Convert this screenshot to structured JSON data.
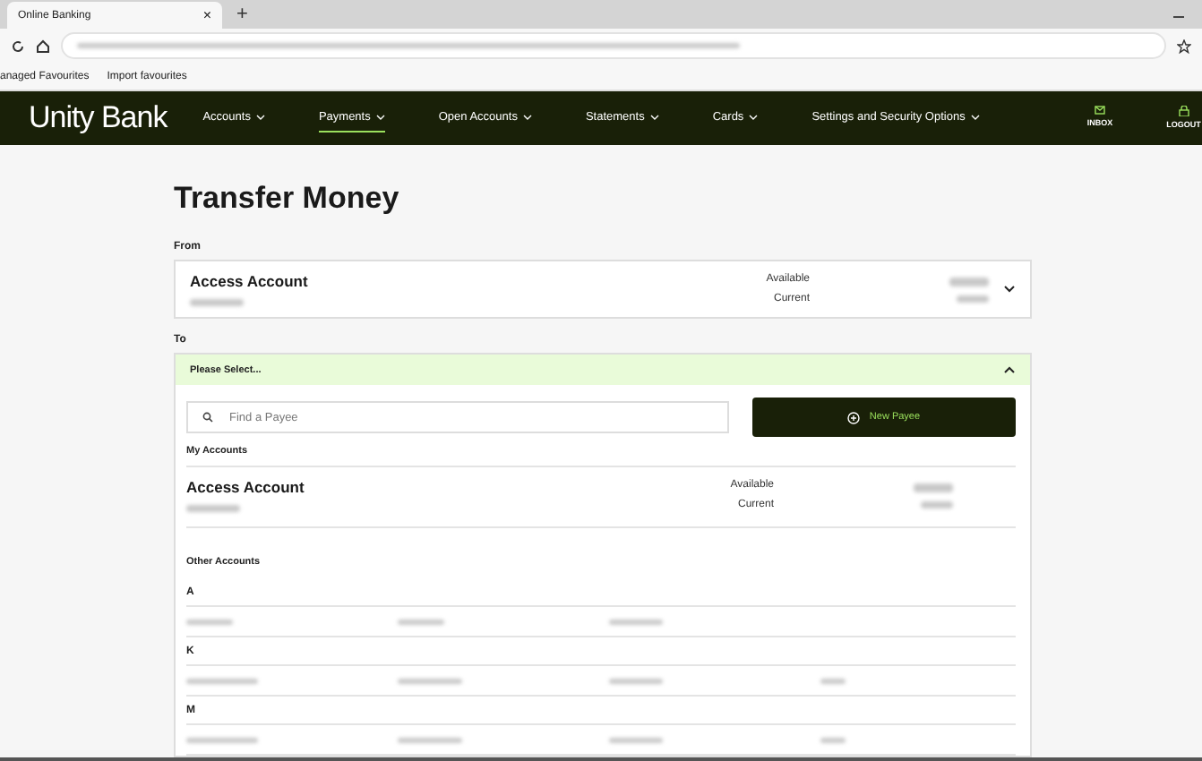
{
  "browser": {
    "tab_title": "Online Banking",
    "tab_close": "×",
    "new_tab": "+",
    "favourites": [
      "anaged Favourites",
      "Import favourites"
    ]
  },
  "nav": {
    "logo": "Unity Bank",
    "items": [
      {
        "label": "Accounts",
        "selected": false
      },
      {
        "label": "Payments",
        "selected": true
      },
      {
        "label": "Open Accounts",
        "selected": false
      },
      {
        "label": "Statements",
        "selected": false
      },
      {
        "label": "Cards",
        "selected": false
      },
      {
        "label": "Settings and Security Options",
        "selected": false
      }
    ],
    "actions": [
      {
        "label": "INBOX",
        "kind": "mail"
      },
      {
        "label": "LOGOUT",
        "kind": "lock"
      }
    ]
  },
  "title": "Transfer Money",
  "from": {
    "label": "From",
    "account": {
      "name": "Access Account",
      "balance_labels": [
        "Available",
        "Current"
      ]
    },
    "expanded": false
  },
  "to": {
    "label": "To",
    "placeholder": "Please Select...",
    "expanded": true,
    "search": {
      "placeholder": "Find a Payee"
    },
    "new_payee": "New Payee",
    "my_accounts": {
      "heading": "My Accounts",
      "account": {
        "name": "Access Account",
        "balance_labels": [
          "Available",
          "Current"
        ]
      }
    },
    "other_accounts": {
      "heading": "Other Accounts",
      "groups": [
        {
          "letter": "A",
          "rows": [
            {
              "kind": "three"
            }
          ]
        },
        {
          "letter": "K",
          "rows": [
            {
              "kind": "four"
            }
          ]
        },
        {
          "letter": "M",
          "rows": [
            {
              "kind": "four"
            }
          ]
        }
      ]
    }
  }
}
